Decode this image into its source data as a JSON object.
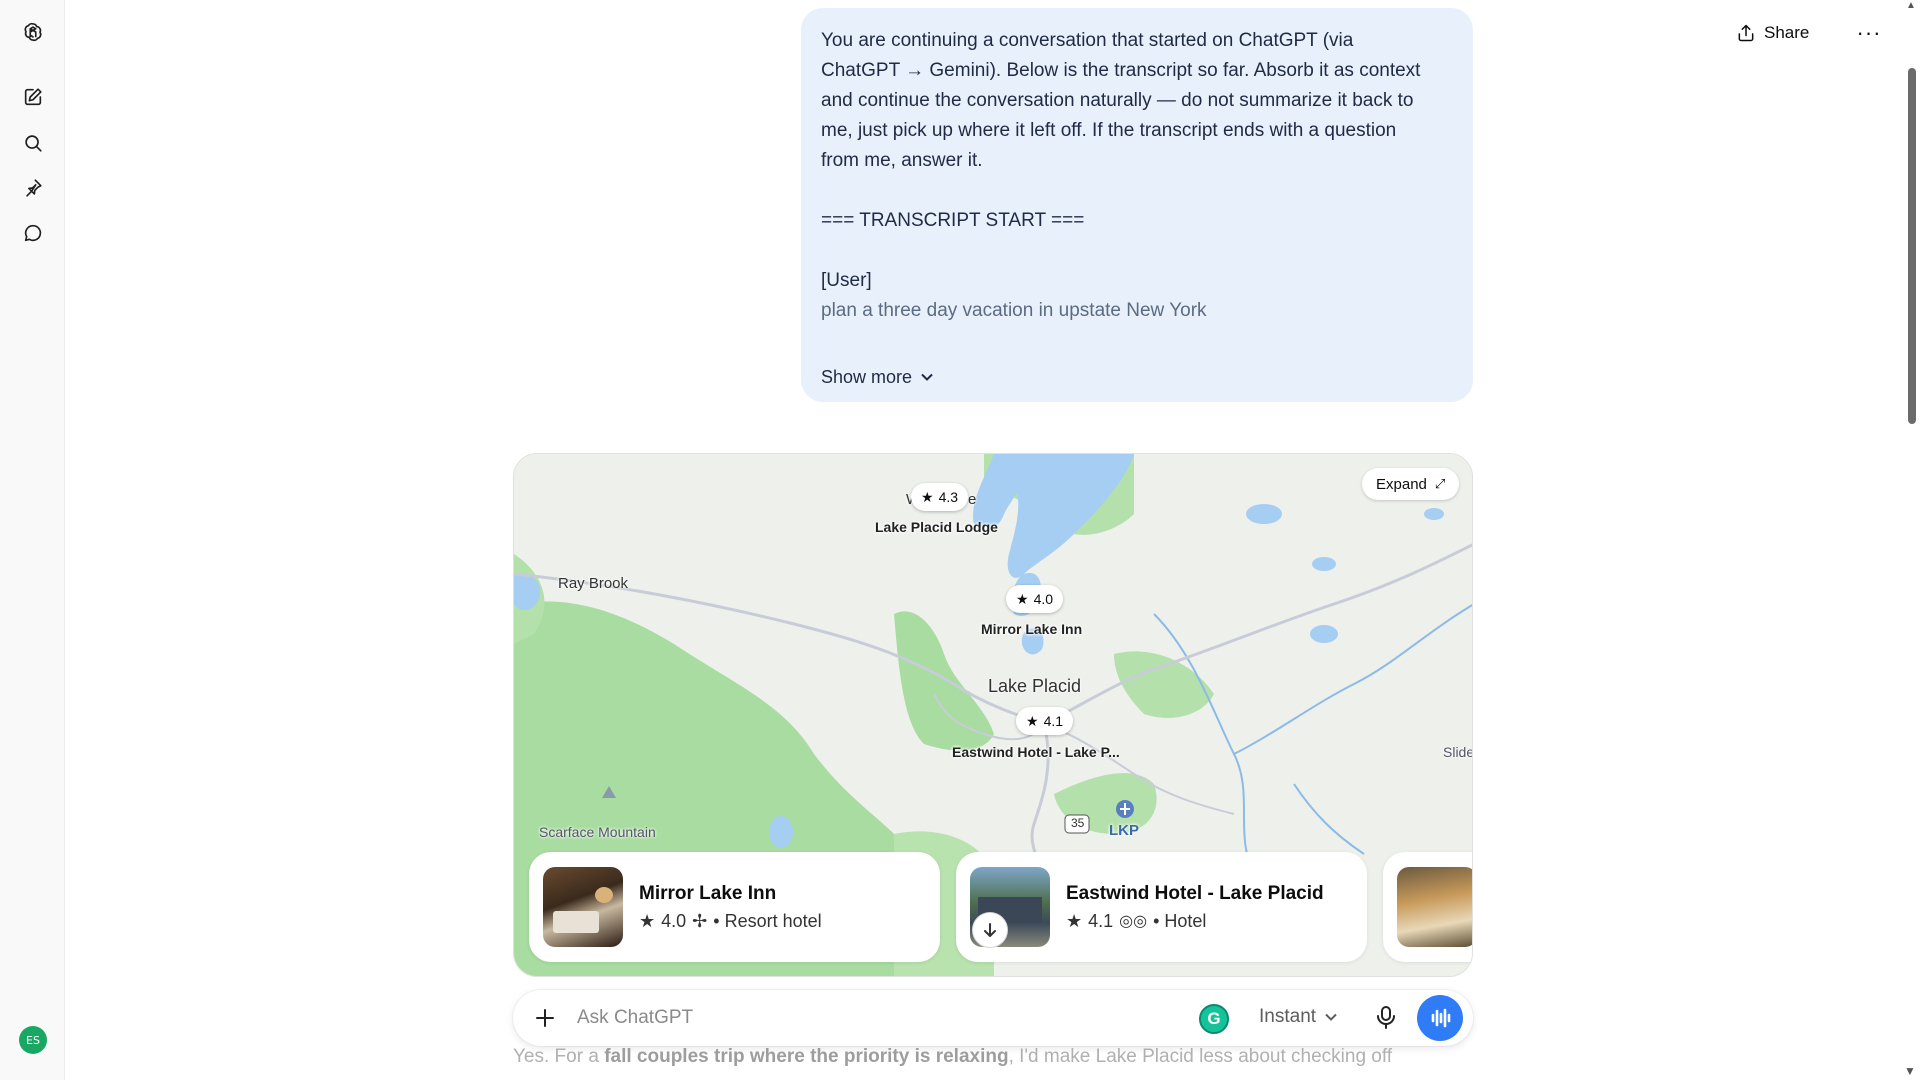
{
  "header": {
    "share_label": "Share",
    "more_label": "···"
  },
  "sidebar": {
    "avatar_initials": "ES"
  },
  "user_message": {
    "lines": [
      "You are continuing a conversation that started on ChatGPT (via",
      "ChatGPT → Gemini). Below is the transcript so far. Absorb it as context",
      "and continue the conversation naturally — do not summarize it back to",
      "me, just pick up where it left off. If the transcript ends with a question",
      "from me, answer it."
    ],
    "transcript_start": "=== TRANSCRIPT START ===",
    "user_tag": "[User]",
    "user_request": "plan a three day vacation in upstate New York",
    "show_more_label": "Show more"
  },
  "map": {
    "expand_label": "Expand",
    "pins": [
      {
        "rating": "4.3",
        "label": "Lake Placid Lodge"
      },
      {
        "rating": "4.0",
        "label": "Mirror Lake Inn"
      },
      {
        "rating": "4.1",
        "label": "Eastwind Hotel - Lake P..."
      }
    ],
    "places": {
      "ray_brook": "Ray Brook",
      "lake_placid": "Lake Placid",
      "scarface": "Scarface Mountain",
      "lkp": "LKP",
      "slide": "Slide",
      "route": "35",
      "partial_w": "W",
      "partial_e": "e"
    },
    "colors": {
      "water": "#a6cdf2",
      "forest": "#a8dca0",
      "land": "#eef0ec"
    }
  },
  "hotels": [
    {
      "name": "Mirror Lake Inn",
      "rating": "4.0",
      "type": "• Resort hotel",
      "icon": "pinwheel-icon"
    },
    {
      "name": "Eastwind Hotel - Lake Placid",
      "rating": "4.1",
      "type": "• Hotel",
      "icon": "tripadvisor-icon"
    }
  ],
  "composer": {
    "placeholder": "Ask ChatGPT",
    "grammarly": "G",
    "model": "Instant"
  },
  "assistant_peek": {
    "pre": "Yes. For a ",
    "bold": "fall couples trip where the priority is relaxing",
    "post": ", I'd make Lake Placid less about checking off"
  }
}
